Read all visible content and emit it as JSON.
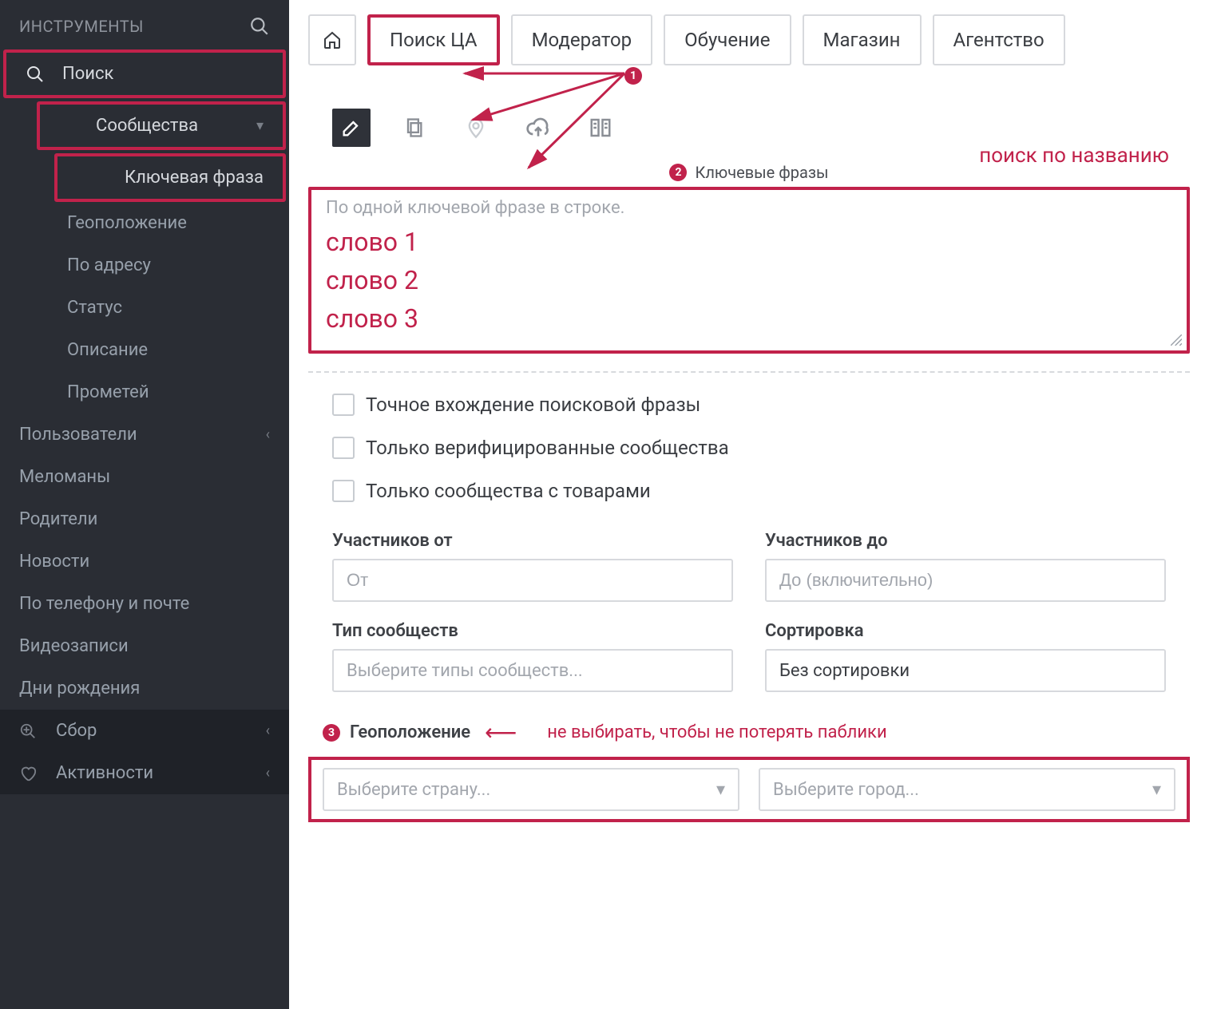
{
  "sidebar": {
    "header": "ИНСТРУМЕНТЫ",
    "items": {
      "search": "Поиск",
      "communities": "Сообщества",
      "keyword": "Ключевая фраза",
      "geolocation": "Геоположение",
      "by_address": "По адресу",
      "status": "Статус",
      "description": "Описание",
      "prometey": "Прометей",
      "users": "Пользователи",
      "melomans": "Меломаны",
      "parents": "Родители",
      "news": "Новости",
      "by_phone_mail": "По телефону и почте",
      "videos": "Видеозаписи",
      "birthdays": "Дни рождения",
      "collect": "Сбор",
      "activities": "Активности"
    }
  },
  "topnav": {
    "search_ta": "Поиск ЦА",
    "moderator": "Модератор",
    "training": "Обучение",
    "shop": "Магазин",
    "agency": "Агентство"
  },
  "section": {
    "keyword_label": "Ключевые фразы",
    "keyword_placeholder": "По одной ключевой фразе в строке.",
    "word1": "слово 1",
    "word2": "слово 2",
    "word3": "слово 3"
  },
  "annotations": {
    "title_hint": "поиск по названию",
    "geo_note": "не выбирать, чтобы не потерять паблики",
    "marker1": "1",
    "marker2": "2",
    "marker3": "3"
  },
  "checks": {
    "exact": "Точное вхождение поисковой фразы",
    "verified": "Только верифицированные сообщества",
    "with_goods": "Только сообщества с товарами"
  },
  "filters": {
    "members_from": "Участников от",
    "members_from_ph": "От",
    "members_to": "Участников до",
    "members_to_ph": "До (включительно)",
    "type": "Тип сообществ",
    "type_ph": "Выберите типы сообществ...",
    "sort": "Сортировка",
    "sort_value": "Без сортировки"
  },
  "geo": {
    "label": "Геоположение",
    "country_ph": "Выберите страну...",
    "city_ph": "Выберите город..."
  }
}
